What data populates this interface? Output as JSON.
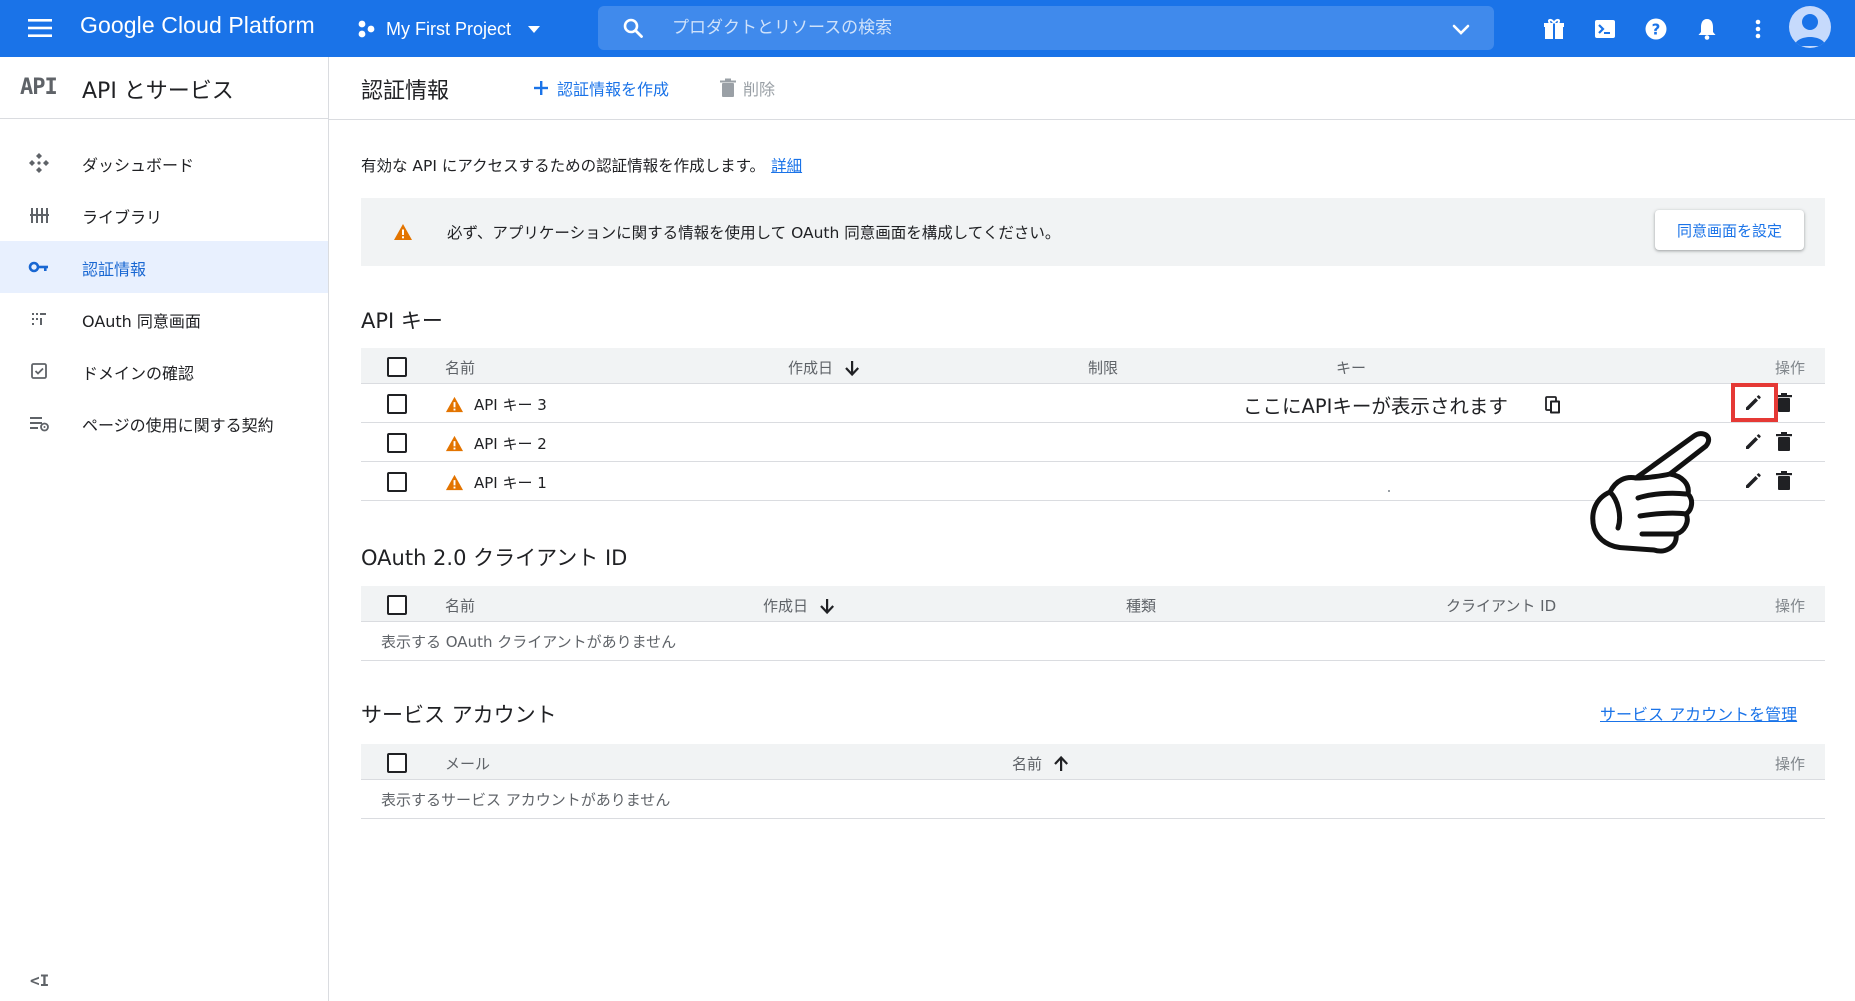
{
  "topbar": {
    "brand": "Google Cloud Platform",
    "project": "My First Project",
    "search_placeholder": "プロダクトとリソースの検索",
    "icons": [
      "menu-icon",
      "gift-icon",
      "terminal-icon",
      "help-icon",
      "bell-icon",
      "more-vert-icon",
      "avatar"
    ],
    "color": "#1a73e8"
  },
  "sidebar": {
    "logo": "API",
    "title": "API とサービス",
    "items": [
      {
        "label": "ダッシュボード",
        "icon": "dashboard-icon"
      },
      {
        "label": "ライブラリ",
        "icon": "library-icon"
      },
      {
        "label": "認証情報",
        "icon": "key-icon",
        "active": true
      },
      {
        "label": "OAuth 同意画面",
        "icon": "consent-icon"
      },
      {
        "label": "ドメインの確認",
        "icon": "domain-check-icon"
      },
      {
        "label": "ページの使用に関する契約",
        "icon": "agreements-icon"
      }
    ],
    "collapse_label": "<I"
  },
  "header": {
    "title": "認証情報",
    "create_label": "認証情報を作成",
    "delete_label": "削除"
  },
  "intro": {
    "text": "有効な API にアクセスするための認証情報を作成します。",
    "link": "詳細"
  },
  "notice": {
    "text": "必ず、アプリケーションに関する情報を使用して OAuth 同意画面を構成してください。",
    "button": "同意画面を設定"
  },
  "api_keys": {
    "title": "API キー",
    "columns": {
      "name": "名前",
      "created": "作成日",
      "restriction": "制限",
      "key": "キー",
      "actions": "操作"
    },
    "rows": [
      {
        "name": "API キー 3",
        "key": "ここにAPIキーが表示されます"
      },
      {
        "name": "API キー 2",
        "key": ""
      },
      {
        "name": "API キー 1",
        "key": ""
      }
    ]
  },
  "oauth": {
    "title": "OAuth 2.0 クライアント ID",
    "columns": {
      "name": "名前",
      "created": "作成日",
      "type": "種類",
      "client_id": "クライアント ID",
      "actions": "操作"
    },
    "empty": "表示する OAuth クライアントがありません"
  },
  "service_accounts": {
    "title": "サービス アカウント",
    "manage_link": "サービス アカウントを管理",
    "columns": {
      "email": "メール",
      "name": "名前",
      "actions": "操作"
    },
    "empty": "表示するサービス アカウントがありません"
  },
  "colors": {
    "accent": "#1a73e8",
    "warning": "#e37400",
    "highlight": "#e53935"
  }
}
